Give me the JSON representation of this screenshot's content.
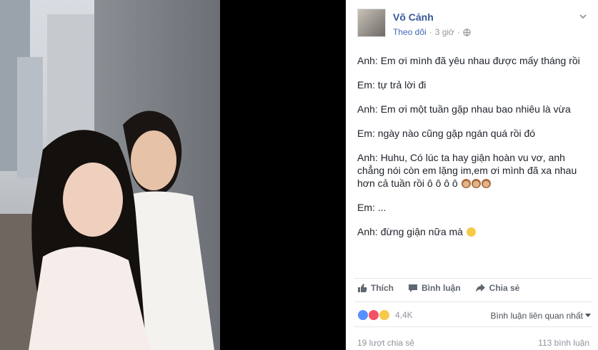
{
  "post": {
    "author": "Võ Cảnh",
    "follow_label": "Theo dõi",
    "separator": "·",
    "time": "3 giờ",
    "lines": [
      "Anh: Em ơi mình đã yêu nhau được mấy tháng rồi",
      "Em: tự trả lời đi",
      "Anh: Em ơi một tuần gặp nhau bao nhiêu là vừa",
      "Em: ngày nào cũng gặp ngán quá rồi đó",
      "Anh: Huhu, Có lúc ta hay giận hoàn vu vơ, anh chẳng nói còn em lặng im,em ơi mình đã xa nhau hơn cả tuần rồi ô ô ô ô",
      "Em: ...",
      "Anh: đừng giận nữa mà"
    ]
  },
  "actions": {
    "like": "Thích",
    "comment": "Bình luận",
    "share": "Chia sẻ"
  },
  "stats": {
    "reactions_count": "4,4K",
    "sort_label": "Bình luận liên quan nhất",
    "shares": "19 lượt chia sẻ",
    "comments": "113 bình luận"
  },
  "colors": {
    "link": "#365899",
    "meta": "#90949c",
    "like": "#5890ff",
    "love": "#f25268"
  },
  "icons": {
    "globe": "globe-icon",
    "chevron": "chevron-down-icon",
    "like": "thumbs-up-icon",
    "comment": "comment-icon",
    "share": "share-arrow-icon"
  }
}
